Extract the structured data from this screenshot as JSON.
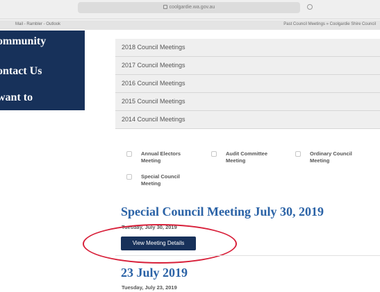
{
  "browser": {
    "url": "coolgardie.wa.gov.au",
    "bookmarks_left": "Mail - Rambler - Outlook",
    "tab_title": "Past Council Meetings » Coolgardie Shire Council"
  },
  "sidebar": {
    "items": [
      "ommunity",
      "ontact Us",
      "want to"
    ]
  },
  "meetings_list": [
    "2018 Council Meetings",
    "2017 Council Meetings",
    "2016 Council Meetings",
    "2015 Council Meetings",
    "2014 Council Meetings"
  ],
  "filters": [
    "Annual Electors\nMeeting",
    "Audit Committee\nMeeting",
    "Ordinary Council\nMeeting",
    "Special Council\nMeeting"
  ],
  "meetings": [
    {
      "title": "Special Council Meeting July 30, 2019",
      "date": "Tuesday, July 30, 2019",
      "button": "View Meeting Details"
    },
    {
      "title": "23 July 2019",
      "date": "Tuesday, July 23, 2019"
    }
  ],
  "annotation": {
    "color": "#d8203a"
  }
}
